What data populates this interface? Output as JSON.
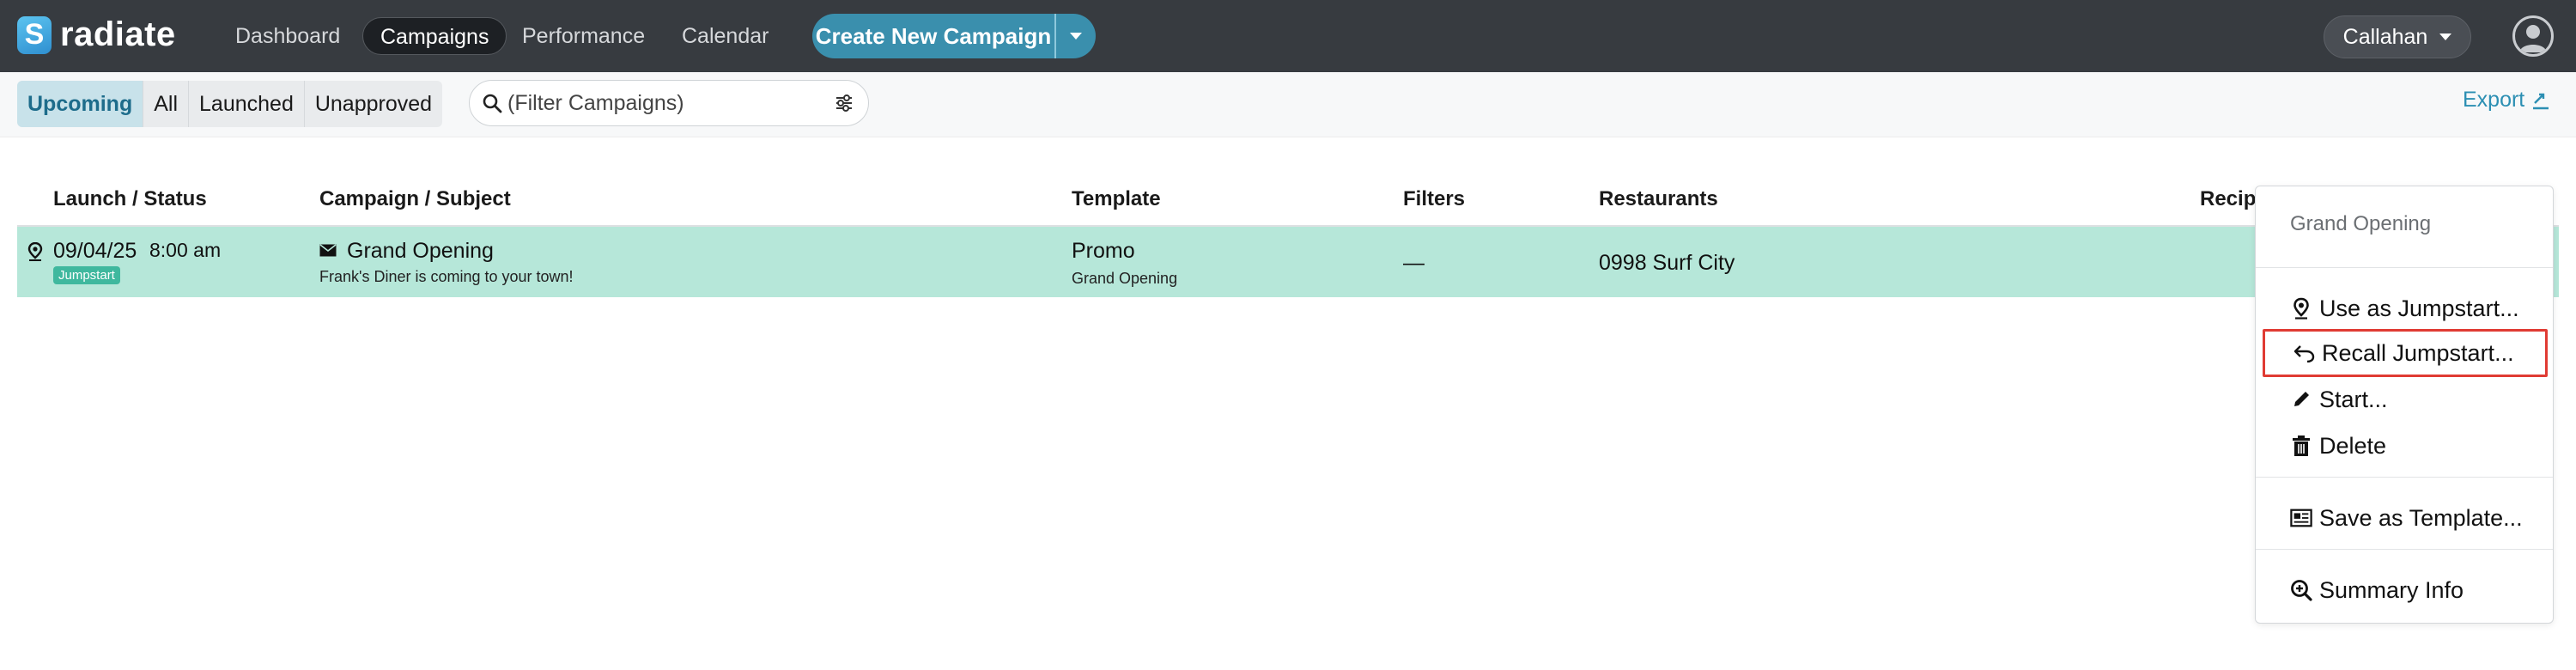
{
  "app": {
    "name": "radiate",
    "logo_letter": "S"
  },
  "nav": {
    "items": [
      {
        "label": "Dashboard",
        "active": false
      },
      {
        "label": "Campaigns",
        "active": true
      },
      {
        "label": "Performance",
        "active": false
      },
      {
        "label": "Calendar",
        "active": false
      }
    ],
    "create_button": "Create New Campaign",
    "user_name": "Callahan"
  },
  "toolbar": {
    "tabs": [
      {
        "label": "Upcoming",
        "active": true
      },
      {
        "label": "All",
        "active": false
      },
      {
        "label": "Launched",
        "active": false
      },
      {
        "label": "Unapproved",
        "active": false
      }
    ],
    "filter_placeholder": "(Filter Campaigns)",
    "export_label": "Export"
  },
  "table": {
    "headers": {
      "launch": "Launch / Status",
      "campaign": "Campaign / Subject",
      "template": "Template",
      "filters": "Filters",
      "restaurants": "Restaurants",
      "recipients": "Recipi"
    },
    "rows": [
      {
        "date": "09/04/25",
        "time": "8:00 am",
        "status_badge": "Jumpstart",
        "campaign": "Grand Opening",
        "subject": "Frank's Diner is coming to your town!",
        "template": "Promo",
        "template_sub": "Grand Opening",
        "filters": "—",
        "restaurants": "0998 Surf City"
      }
    ]
  },
  "context_menu": {
    "title": "Grand Opening",
    "items": [
      {
        "label": "Use as Jumpstart...",
        "icon": "map-pin-icon"
      },
      {
        "label": "Recall Jumpstart...",
        "icon": "undo-arrow-icon",
        "highlighted": true
      },
      {
        "label": "Start...",
        "icon": "pencil-icon"
      },
      {
        "label": "Delete",
        "icon": "trash-icon"
      },
      {
        "label": "Save as Template...",
        "icon": "newspaper-icon"
      },
      {
        "label": "Summary Info",
        "icon": "zoom-in-icon"
      }
    ]
  },
  "colors": {
    "topbar": "#373b40",
    "accent": "#3a8fad",
    "row_highlight": "#b6e7d9",
    "badge": "#3fb89e",
    "highlight_border": "#e03b33"
  }
}
